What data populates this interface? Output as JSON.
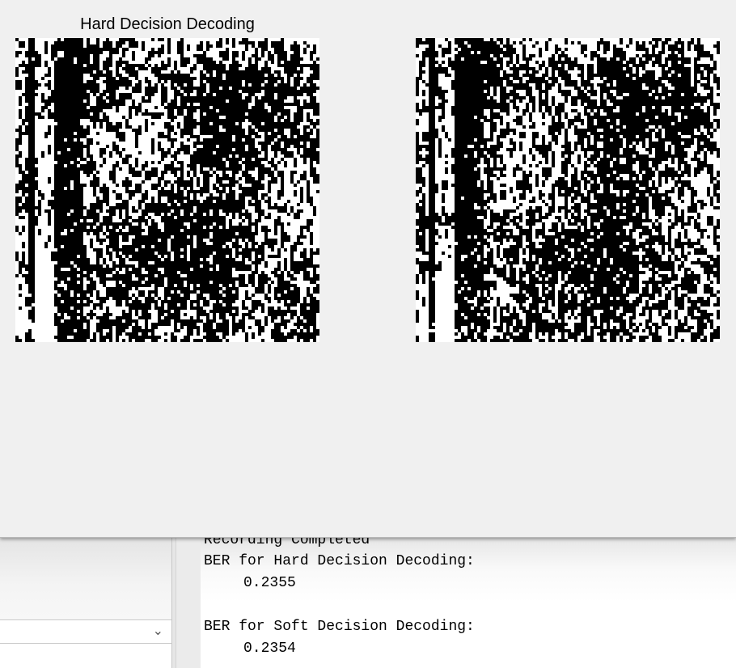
{
  "figure": {
    "axes": [
      {
        "title": "Hard Decision Decoding"
      },
      {
        "title": ""
      }
    ],
    "image_colors": {
      "black": "#000000",
      "white": "#ffffff"
    }
  },
  "command_window": {
    "lines": [
      "Recording Completed",
      "BER for Hard Decision Decoding:",
      "0.2355",
      "",
      "BER for Soft Decision Decoding:",
      "0.2354"
    ]
  },
  "left_panel": {
    "dropdown_icon": "chevron-down-icon"
  }
}
